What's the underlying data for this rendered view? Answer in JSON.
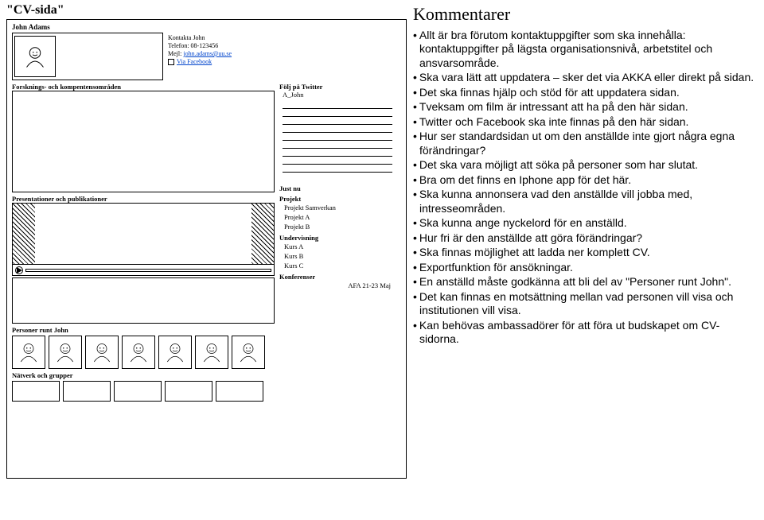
{
  "page_title": "\"CV-sida\"",
  "wire": {
    "person_name": "John Adams",
    "contact": {
      "title": "Kontakta John",
      "phone_label": "Telefon: 08-123456",
      "email_label": "Mejl:",
      "email_link": "john.adams@uu.se",
      "fb_link": "Via Facebook"
    },
    "sections": {
      "research": "Forsknings- och kompentensområden",
      "twitter_label": "Följ på Twitter",
      "twitter_handle": "A_John",
      "now_label": "Just nu",
      "project_label": "Projekt",
      "projects": [
        "Projekt Samverkan",
        "Projekt A",
        "Projekt B"
      ],
      "teaching_label": "Undervisning",
      "courses": [
        "Kurs A",
        "Kurs B",
        "Kurs C"
      ],
      "conf_label": "Konferenser",
      "conf_item": "AFA 21-23 Maj",
      "pres_label": "Presentationer och publikationer",
      "people_label": "Personer runt John",
      "net_label": "Nätverk och grupper"
    }
  },
  "comments": {
    "title": "Kommentarer",
    "items": [
      "Allt är bra förutom kontaktuppgifter som ska innehålla: kontaktuppgifter på lägsta organisationsnivå, arbetstitel och ansvarsområde.",
      "Ska vara lätt att uppdatera – sker det via AKKA eller direkt på sidan.",
      "Det ska finnas hjälp och stöd för att uppdatera sidan.",
      "Tveksam om film är intressant att ha på den här sidan.",
      "Twitter och Facebook ska inte finnas på den här sidan.",
      "Hur ser standardsidan ut om den anställde inte gjort några egna förändringar?",
      "Det ska vara möjligt att söka på personer som har slutat.",
      "Bra om det finns en Iphone app för det här.",
      "Ska kunna annonsera vad den anställde vill jobba med, intresseområden.",
      "Ska kunna ange nyckelord för en anställd.",
      "Hur fri är den anställde att göra förändringar?",
      "Ska finnas möjlighet att ladda ner komplett CV.",
      "Exportfunktion för ansökningar.",
      "En anställd måste godkänna att bli del av \"Personer runt John\".",
      "Det kan finnas en motsättning mellan vad personen vill visa och institutionen vill visa.",
      "Kan behövas ambassadörer för att föra ut budskapet om CV-sidorna."
    ]
  }
}
